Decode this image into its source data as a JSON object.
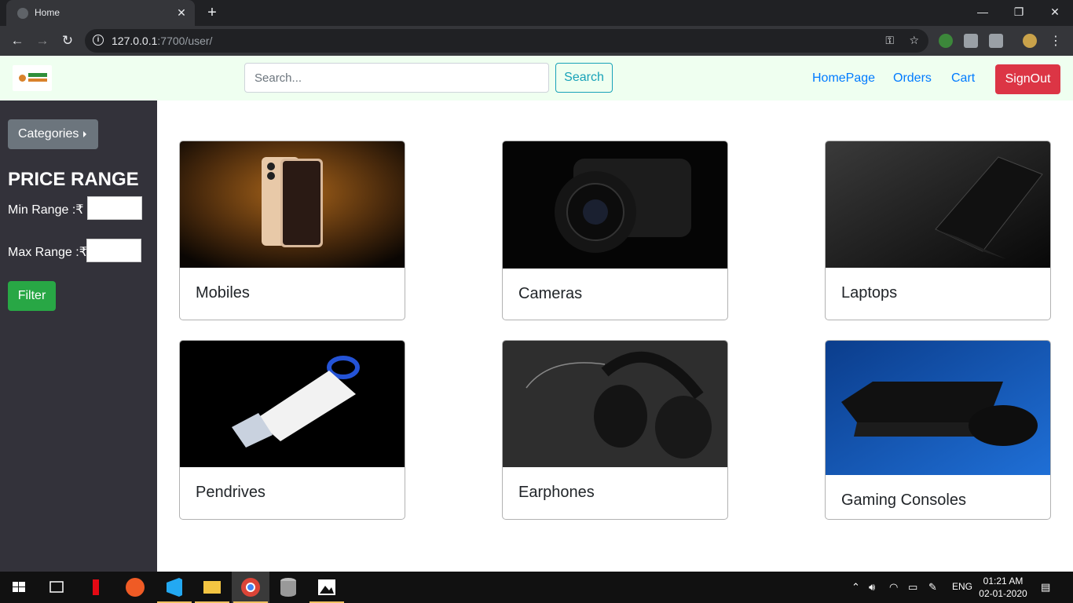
{
  "browser": {
    "tab_title": "Home",
    "url_host": "127.0.0.1",
    "url_rest": ":7700/user/"
  },
  "navbar": {
    "search_placeholder": "Search...",
    "search_label": "Search",
    "links": [
      "HomePage",
      "Orders",
      "Cart"
    ],
    "signout_label": "SignOut"
  },
  "sidebar": {
    "categories_label": "Categories",
    "price_title": "PRICE RANGE",
    "min_label": "Min Range  :₹",
    "max_label": "Max Range :₹",
    "filter_label": "Filter"
  },
  "products": [
    {
      "title": "Mobiles"
    },
    {
      "title": "Cameras"
    },
    {
      "title": "Laptops"
    },
    {
      "title": "Pendrives"
    },
    {
      "title": "Earphones"
    },
    {
      "title": "Gaming Consoles"
    }
  ],
  "taskbar": {
    "lang": "ENG",
    "time": "01:21 AM",
    "date": "02-01-2020"
  },
  "colors": {
    "navbar_bg": "#effff0",
    "sidebar_bg": "#33323a",
    "signout": "#dc3545",
    "filter": "#28a745",
    "search_outline": "#17a2b8",
    "link": "#007bff"
  }
}
